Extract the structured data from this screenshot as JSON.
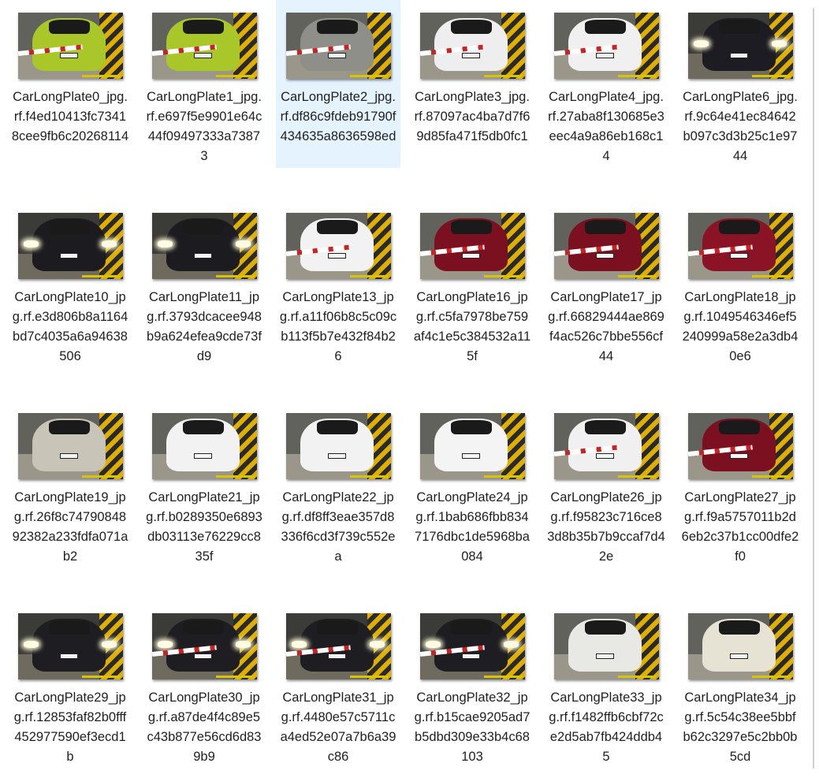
{
  "files": [
    {
      "name": "CarLongPlate0_jpg.rf.f4ed10413fc73418cee9fb6c20268114",
      "car_color": "#a9c728",
      "night": false,
      "barrier": true
    },
    {
      "name": "CarLongPlate1_jpg.rf.e697f5e9901e64c44f09497333a73873",
      "car_color": "#a9c728",
      "night": false,
      "barrier": true
    },
    {
      "name": "CarLongPlate2_jpg.rf.df86c9fdeb91790f434635a8636598ed",
      "car_color": "#8f8f8a",
      "night": false,
      "barrier": true,
      "selected": true
    },
    {
      "name": "CarLongPlate3_jpg.rf.87097ac4ba7d7f69d85fa471f5db0fc1",
      "car_color": "#eeeeee",
      "night": false,
      "barrier": true
    },
    {
      "name": "CarLongPlate4_jpg.rf.27aba8f130685e3eec4a9a86eb168c14",
      "car_color": "#f0f0f0",
      "night": false,
      "barrier": true
    },
    {
      "name": "CarLongPlate6_jpg.rf.9c64e41ec84642b097c3d3b25c1e9744",
      "car_color": "#1c1c22",
      "night": true,
      "barrier": false
    },
    {
      "name": "CarLongPlate10_jpg.rf.e3d806b8a1164bd7c4035a6a94638506",
      "car_color": "#1c1c20",
      "night": true,
      "barrier": false
    },
    {
      "name": "CarLongPlate11_jpg.rf.3793dcacee948b9a624efea9cde73fd9",
      "car_color": "#1c1c20",
      "night": true,
      "barrier": false
    },
    {
      "name": "CarLongPlate13_jpg.rf.a11f06b8c5c09cb113f5b7e432f84b26",
      "car_color": "#f2f2f2",
      "night": false,
      "barrier": true
    },
    {
      "name": "CarLongPlate16_jpg.rf.c5fa7978be759af4c1e5c384532a115f",
      "car_color": "#7a1020",
      "night": false,
      "barrier": true
    },
    {
      "name": "CarLongPlate17_jpg.rf.66829444ae869f4ac526c7bbe556cf44",
      "car_color": "#7a1020",
      "night": false,
      "barrier": true
    },
    {
      "name": "CarLongPlate18_jpg.rf.1049546346ef5240999a58e2a3db40e6",
      "car_color": "#8a1426",
      "night": false,
      "barrier": true
    },
    {
      "name": "CarLongPlate19_jpg.rf.26f8c7479084892382a233fdfa071ab2",
      "car_color": "#c8c4b8",
      "night": false,
      "barrier": false
    },
    {
      "name": "CarLongPlate21_jpg.rf.b0289350e6893db03113e76229cc835f",
      "car_color": "#f2f2f2",
      "night": false,
      "barrier": false
    },
    {
      "name": "CarLongPlate22_jpg.rf.df8ff3eae357d8336f6cd3f739c552ea",
      "car_color": "#f2f2f2",
      "night": false,
      "barrier": false
    },
    {
      "name": "CarLongPlate24_jpg.rf.1bab686fbb8347176dbc1de5968ba084",
      "car_color": "#f4f4f4",
      "night": false,
      "barrier": false
    },
    {
      "name": "CarLongPlate26_jpg.rf.f95823c716ce83d8b35b7b9ccaf7d42e",
      "car_color": "#f0f0f0",
      "night": false,
      "barrier": true
    },
    {
      "name": "CarLongPlate27_jpg.rf.f9a5757011b2d6eb2c37b1cc00dfe2f0",
      "car_color": "#7a1020",
      "night": false,
      "barrier": true
    },
    {
      "name": "CarLongPlate29_jpg.rf.12853faf82b0fff452977590ef3ecd1b",
      "car_color": "#1e1e22",
      "night": true,
      "barrier": false
    },
    {
      "name": "CarLongPlate30_jpg.rf.a87de4f4c89e5c43b877e56cd6d839b9",
      "car_color": "#1e1e22",
      "night": true,
      "barrier": true
    },
    {
      "name": "CarLongPlate31_jpg.rf.4480e57c5711ca4ed52e07a7b6a39c86",
      "car_color": "#1e1e22",
      "night": true,
      "barrier": true
    },
    {
      "name": "CarLongPlate32_jpg.rf.b15cae9205ad7b5dbd309e33b4c68103",
      "car_color": "#1e1e22",
      "night": true,
      "barrier": true
    },
    {
      "name": "CarLongPlate33_jpg.rf.f1482ffb6cbf72ce2d5ab7fb424ddb45",
      "car_color": "#e8e8e4",
      "night": false,
      "barrier": false
    },
    {
      "name": "CarLongPlate34_jpg.rf.5c54c38ee5bbfb62c3297e5c2bb0b5cd",
      "car_color": "#e6e2d4",
      "night": false,
      "barrier": false
    }
  ]
}
